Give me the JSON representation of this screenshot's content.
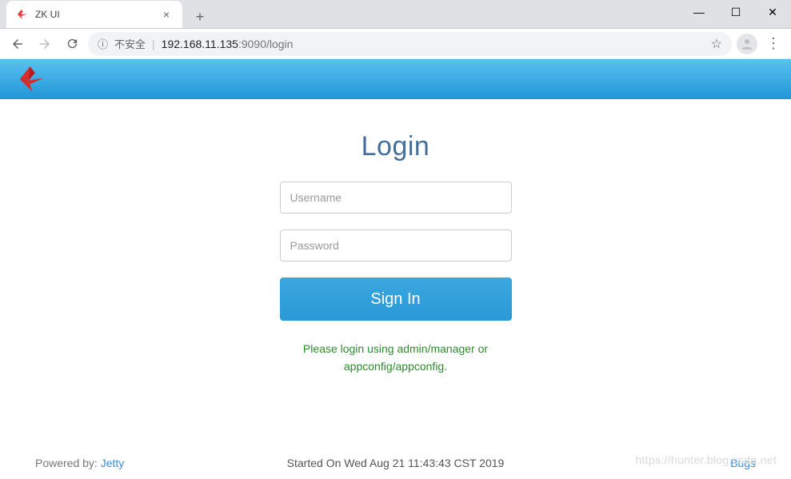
{
  "browser": {
    "tab_title": "ZK UI",
    "insecure_label": "不安全",
    "url_host": "192.168.11.135",
    "url_portpath": ":9090/login"
  },
  "header": {},
  "login": {
    "title": "Login",
    "username_placeholder": "Username",
    "password_placeholder": "Password",
    "signin_label": "Sign In",
    "hint_line1": "Please login using admin/manager or",
    "hint_line2": "appconfig/appconfig."
  },
  "footer": {
    "powered_by_label": "Powered by: ",
    "powered_by_link": "Jetty",
    "started_on": "Started On Wed Aug 21 11:43:43 CST 2019",
    "bugs_link": "Bugs"
  },
  "watermark": "https://hunter.blog.csdn.net"
}
